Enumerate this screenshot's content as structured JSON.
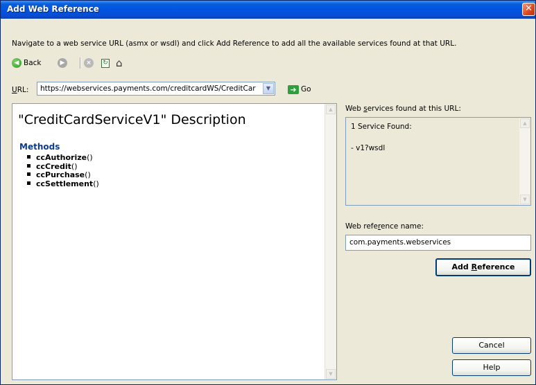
{
  "window": {
    "title": "Add Web Reference",
    "close_glyph": "✕"
  },
  "instruction": "Navigate to a web service URL (asmx or wsdl) and click Add Reference to add all the available services found at that URL.",
  "toolbar": {
    "back_label": "Back",
    "icons": [
      "back-icon",
      "forward-icon",
      "stop-icon",
      "refresh-icon",
      "home-icon"
    ]
  },
  "url": {
    "label_prefix": "U",
    "label_rest": "RL:",
    "value": "https://webservices.payments.com/creditcardWS/CreditCar",
    "go_label": "Go"
  },
  "description": {
    "title": "\"CreditCardServiceV1\" Description",
    "methods_heading": "Methods",
    "methods": [
      {
        "name": "ccAuthorize",
        "suffix": "()"
      },
      {
        "name": "ccCredit",
        "suffix": "()"
      },
      {
        "name": "ccPurchase",
        "suffix": "()"
      },
      {
        "name": "ccSettlement",
        "suffix": "()"
      }
    ]
  },
  "services": {
    "label_pre": "Web ",
    "label_u": "s",
    "label_post": "ervices found at this URL:",
    "count_text": "1 Service Found:",
    "items": [
      "- v1?wsdl"
    ]
  },
  "reference": {
    "label_pre": "Web refe",
    "label_u": "r",
    "label_post": "ence name:",
    "value": "com.payments.webservices"
  },
  "buttons": {
    "add_reference_pre": "Add ",
    "add_reference_u": "R",
    "add_reference_post": "eference",
    "cancel": "Cancel",
    "help": "Help"
  },
  "colors": {
    "titlebar": "#0054e3",
    "dialog_bg": "#ece9d8",
    "methods_heading": "#0a3d91",
    "go_arrow": "#2f9e3c"
  }
}
